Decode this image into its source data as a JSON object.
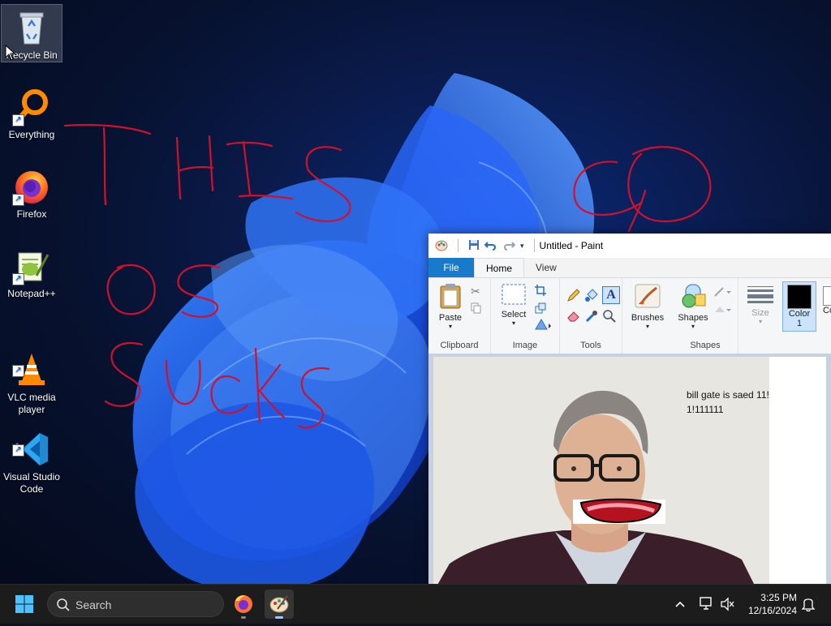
{
  "desktop": {
    "icons": [
      {
        "label": "Recycle Bin",
        "icon": "recycle-bin-icon"
      },
      {
        "label": "Everything",
        "icon": "everything-search-icon"
      },
      {
        "label": "Firefox",
        "icon": "firefox-icon"
      },
      {
        "label": "Notepad++",
        "icon": "notepadpp-icon"
      },
      {
        "label": "VLC media\nplayer",
        "icon": "vlc-icon"
      },
      {
        "label": "Visual Studio\nCode",
        "icon": "vscode-icon"
      }
    ],
    "scribble_color": "#d0112b"
  },
  "paint": {
    "title": "Untitled - Paint",
    "tabs": {
      "file": "File",
      "home": "Home",
      "view": "View"
    },
    "ribbon": {
      "paste": "Paste",
      "select": "Select",
      "brushes": "Brushes",
      "shapes": "Shapes",
      "size": "Size",
      "color1": "Color\n1",
      "color2": "Co",
      "groups": {
        "clipboard": "Clipboard",
        "image": "Image",
        "tools": "Tools",
        "shapes": "Shapes"
      }
    },
    "canvas_text": "bill gate is saed 11!!!!\n1!111111",
    "accent": "#1979ca"
  },
  "taskbar": {
    "search_placeholder": "Search",
    "time": "3:25 PM",
    "date": "12/16/2024"
  }
}
